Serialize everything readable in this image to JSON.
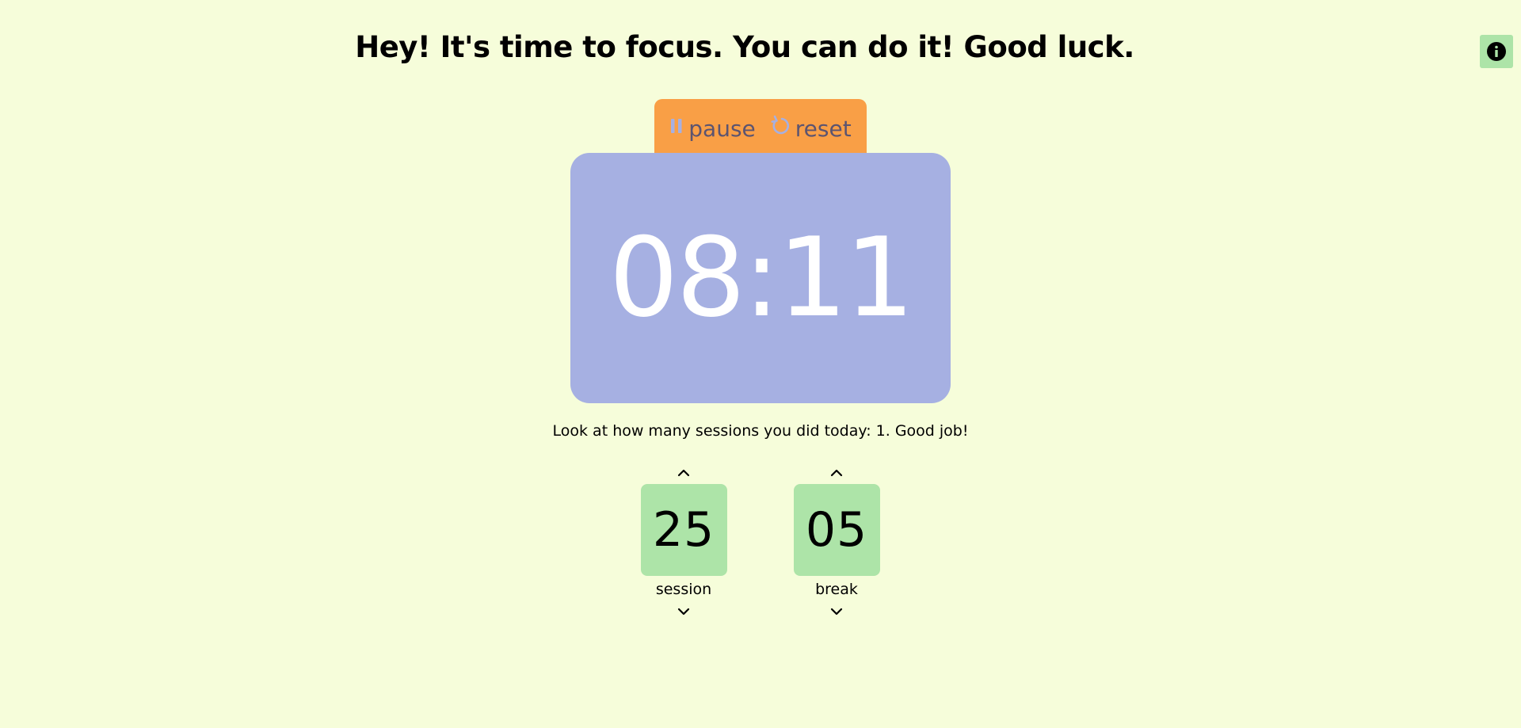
{
  "header": {
    "headline": "Hey! It's time to focus. You can do it! Good luck."
  },
  "info_button": {
    "icon": "info-icon"
  },
  "controls": {
    "pause_label": "pause",
    "pause_icon": "pause-icon",
    "reset_label": "reset",
    "reset_icon": "reset-icon"
  },
  "timer": {
    "display": "08:11"
  },
  "sessions": {
    "message": "Look at how many sessions you did today: 1. Good job!"
  },
  "setters": {
    "session": {
      "value": "25",
      "label": "session",
      "up_icon": "chevron-up-icon",
      "down_icon": "chevron-down-icon"
    },
    "break": {
      "value": "05",
      "label": "break",
      "up_icon": "chevron-up-icon",
      "down_icon": "chevron-down-icon"
    }
  },
  "colors": {
    "background": "#f6fdda",
    "controls": "#f99f46",
    "timer_card": "#a6b0e2",
    "setter_box": "#ade4a8",
    "info_button": "#ade4a8"
  }
}
